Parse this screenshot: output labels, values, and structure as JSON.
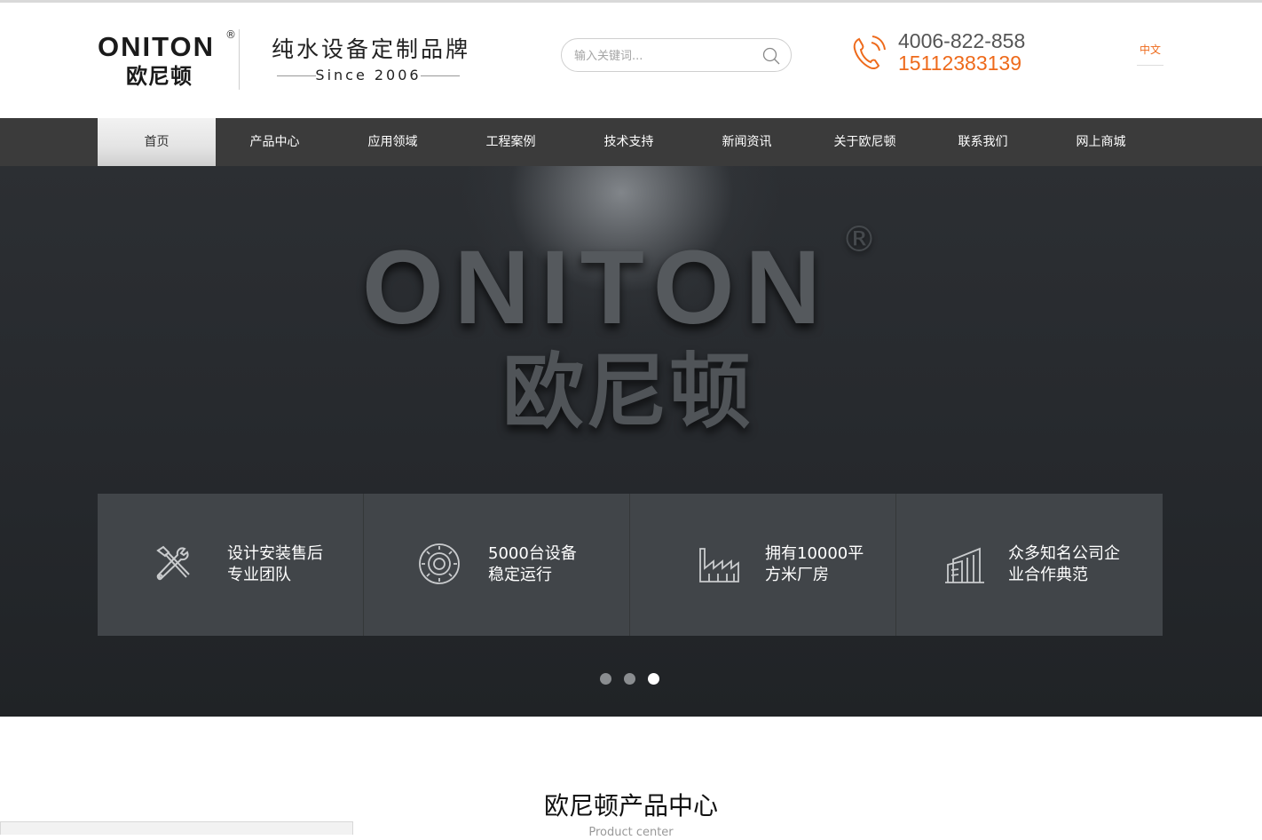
{
  "header": {
    "logo_en": "ONITON",
    "logo_reg": "®",
    "logo_cn": "欧尼顿",
    "slogan": "纯水设备定制品牌",
    "since": "Since 2006",
    "search_placeholder": "输入关键词...",
    "phone_hotline": "4006-822-858",
    "phone_mobile": "15112383139",
    "language": "中文"
  },
  "nav": {
    "items": [
      {
        "label": "首页"
      },
      {
        "label": "产品中心"
      },
      {
        "label": "应用领域"
      },
      {
        "label": "工程案例"
      },
      {
        "label": "技术支持"
      },
      {
        "label": "新闻资讯"
      },
      {
        "label": "关于欧尼顿"
      },
      {
        "label": "联系我们"
      },
      {
        "label": "网上商城"
      }
    ],
    "active_index": 0
  },
  "banner": {
    "brand_en": "ONITON",
    "brand_reg": "®",
    "brand_cn": "欧尼顿",
    "features": [
      {
        "icon": "tools-icon",
        "line1": "设计安装售后",
        "line2": "专业团队"
      },
      {
        "icon": "gear-icon",
        "line1": "5000台设备",
        "line2": "稳定运行"
      },
      {
        "icon": "factory-icon",
        "line1": "拥有10000平",
        "line2": "方米厂房"
      },
      {
        "icon": "building-icon",
        "line1": "众多知名公司企",
        "line2": "业合作典范"
      }
    ],
    "slides": 3,
    "current_slide": 3
  },
  "products": {
    "title": "欧尼顿产品中心",
    "subtitle": "Product center"
  },
  "colors": {
    "accent": "#ee6a1b",
    "nav_bg": "#3b3b3b",
    "feature_bg": "#414549"
  }
}
